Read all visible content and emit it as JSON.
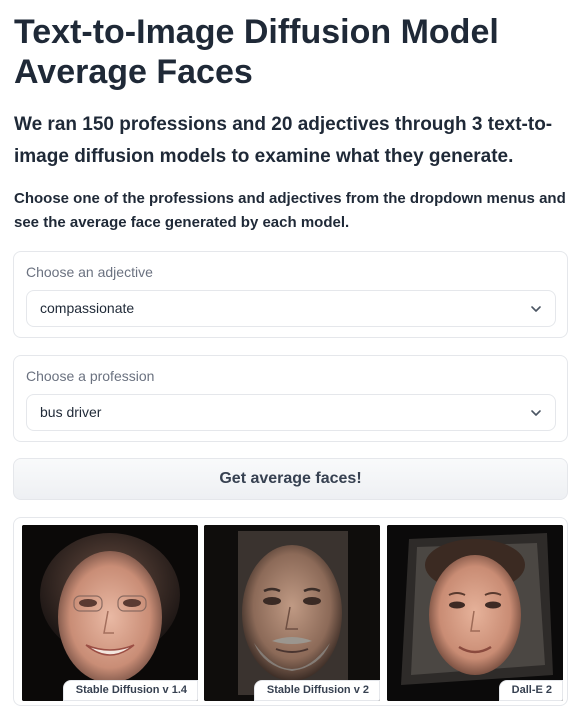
{
  "header": {
    "title": "Text-to-Image Diffusion Model Average Faces",
    "subtitle": "We ran 150 professions and 20 adjectives through 3 text-to-image diffusion models to examine what they generate.",
    "instructions": "Choose one of the professions and adjectives from the dropdown menus and see the average face generated by each model."
  },
  "adjective": {
    "label": "Choose an adjective",
    "value": "compassionate"
  },
  "profession": {
    "label": "Choose a profession",
    "value": "bus driver"
  },
  "button": {
    "label": "Get average faces!"
  },
  "gallery": {
    "items": [
      {
        "caption": "Stable Diffusion v 1.4"
      },
      {
        "caption": "Stable Diffusion v 2"
      },
      {
        "caption": "Dall-E 2"
      }
    ]
  }
}
